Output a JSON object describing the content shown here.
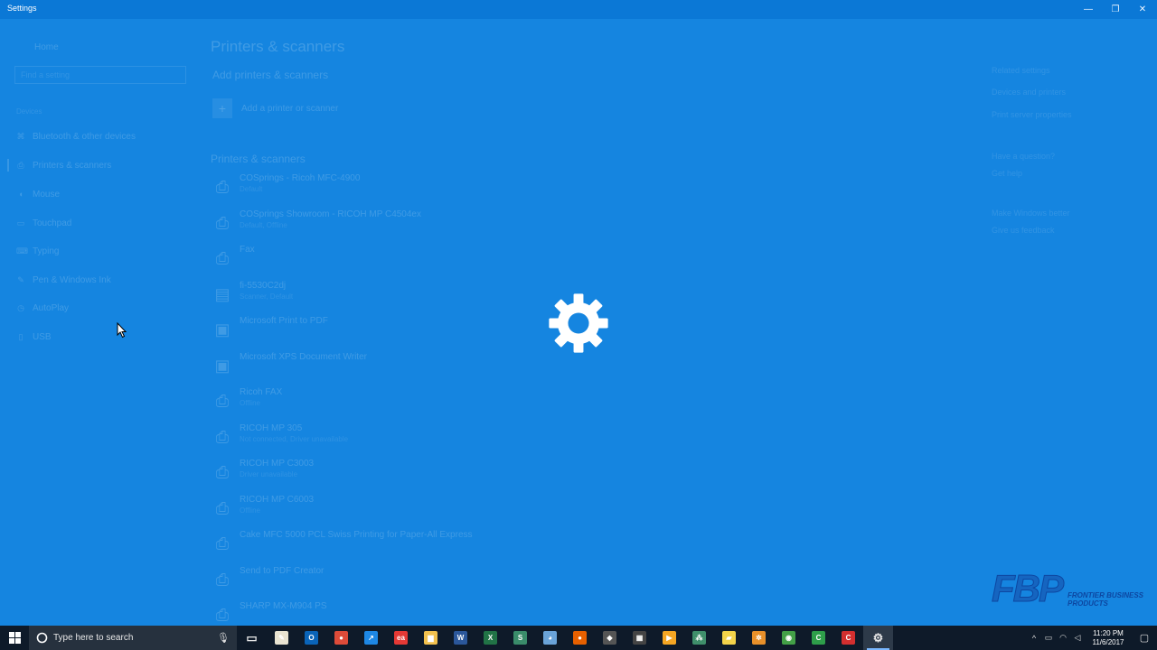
{
  "window": {
    "title": "Settings",
    "controls": {
      "minimize": "—",
      "restore": "❐",
      "close": "✕"
    }
  },
  "sidebar": {
    "home": "Home",
    "search_placeholder": "Find a setting",
    "section": "Devices",
    "items": [
      {
        "label": "Bluetooth & other devices",
        "icon": "bluetooth-icon",
        "glyph": "⌘"
      },
      {
        "label": "Printers & scanners",
        "icon": "printer-icon",
        "glyph": "⎙",
        "active": true
      },
      {
        "label": "Mouse",
        "icon": "mouse-icon",
        "glyph": "◖"
      },
      {
        "label": "Touchpad",
        "icon": "touchpad-icon",
        "glyph": "▭"
      },
      {
        "label": "Typing",
        "icon": "keyboard-icon",
        "glyph": "⌨"
      },
      {
        "label": "Pen & Windows Ink",
        "icon": "pen-icon",
        "glyph": "✎"
      },
      {
        "label": "AutoPlay",
        "icon": "autoplay-icon",
        "glyph": "◷"
      },
      {
        "label": "USB",
        "icon": "usb-icon",
        "glyph": "▯"
      }
    ]
  },
  "main": {
    "title": "Printers & scanners",
    "add_heading": "Add printers & scanners",
    "add_button": "Add a printer or scanner",
    "list_heading": "Printers & scanners",
    "printers": [
      {
        "name": "COSprings - Ricoh MFC-4900",
        "status": "Default",
        "icon": "printer-icon"
      },
      {
        "name": "COSprings Showroom - RICOH MP C4504ex",
        "status": "Default, Offline",
        "icon": "printer-icon"
      },
      {
        "name": "Fax",
        "status": "",
        "icon": "printer-icon"
      },
      {
        "name": "fi-5530C2dj",
        "status": "Scanner, Default",
        "icon": "scanner-icon"
      },
      {
        "name": "Microsoft Print to PDF",
        "status": "",
        "icon": "pdf-printer-icon"
      },
      {
        "name": "Microsoft XPS Document Writer",
        "status": "",
        "icon": "xps-printer-icon"
      },
      {
        "name": "Ricoh FAX",
        "status": "Offline",
        "icon": "printer-icon"
      },
      {
        "name": "RICOH MP 305",
        "status": "Not connected, Driver unavailable",
        "icon": "printer-icon"
      },
      {
        "name": "RICOH MP C3003",
        "status": "Driver unavailable",
        "icon": "printer-icon"
      },
      {
        "name": "RICOH MP C6003",
        "status": "Offline",
        "icon": "printer-icon"
      },
      {
        "name": "Cake MFC 5000 PCL Swiss Printing for Paper-All Express",
        "status": "",
        "icon": "printer-icon"
      },
      {
        "name": "Send to PDF Creator",
        "status": "",
        "icon": "printer-icon"
      },
      {
        "name": "SHARP MX-M904 PS",
        "status": "",
        "icon": "printer-icon"
      }
    ]
  },
  "related": {
    "heading": "Related settings",
    "links": [
      "Devices and printers",
      "Print server properties"
    ],
    "question_heading": "Have a question?",
    "question_link": "Get help",
    "feedback_heading": "Make Windows better",
    "feedback_link": "Give us feedback"
  },
  "overlay": {
    "spinner_icon": "gear-icon"
  },
  "logo": {
    "mark": "FBP",
    "line1": "FRONTIER BUSINESS",
    "line2": "PRODUCTS"
  },
  "taskbar": {
    "search_placeholder": "Type here to search",
    "apps": [
      {
        "name": "task-view",
        "glyph": "▭",
        "bg": "transparent"
      },
      {
        "name": "notepad",
        "glyph": "✎",
        "bg": "#e9e4d2"
      },
      {
        "name": "outlook",
        "glyph": "O",
        "bg": "#0a64b8"
      },
      {
        "name": "chrome",
        "glyph": "●",
        "bg": "#dd4b39"
      },
      {
        "name": "app-blue",
        "glyph": "↗",
        "bg": "#1e88e5"
      },
      {
        "name": "app-red",
        "glyph": "ea",
        "bg": "#e53935"
      },
      {
        "name": "file-explorer",
        "glyph": "▆",
        "bg": "#f2c14e"
      },
      {
        "name": "word",
        "glyph": "W",
        "bg": "#2b579a"
      },
      {
        "name": "excel",
        "glyph": "X",
        "bg": "#217346"
      },
      {
        "name": "app-s",
        "glyph": "S",
        "bg": "#3a8c6a"
      },
      {
        "name": "paint",
        "glyph": "◕",
        "bg": "#6aa3d8"
      },
      {
        "name": "firefox",
        "glyph": "●",
        "bg": "#e66000"
      },
      {
        "name": "app-box",
        "glyph": "◆",
        "bg": "#555"
      },
      {
        "name": "calculator",
        "glyph": "▦",
        "bg": "#444"
      },
      {
        "name": "media-player",
        "glyph": "▶",
        "bg": "#f5a623"
      },
      {
        "name": "app-dots",
        "glyph": "⁂",
        "bg": "#3f8f6b"
      },
      {
        "name": "sticky-notes",
        "glyph": "▰",
        "bg": "#f3d34a"
      },
      {
        "name": "app-orange",
        "glyph": "✲",
        "bg": "#e8902a"
      },
      {
        "name": "app-green",
        "glyph": "◉",
        "bg": "#43a047"
      },
      {
        "name": "camtasia",
        "glyph": "C",
        "bg": "#2e9e4a"
      },
      {
        "name": "app-red-c",
        "glyph": "C",
        "bg": "#d32f2f"
      },
      {
        "name": "settings",
        "glyph": "⚙",
        "bg": "transparent",
        "active": true
      }
    ],
    "tray": {
      "time": "11:20 PM",
      "date": "11/6/2017"
    }
  },
  "colors": {
    "background": "#1585e0",
    "titlebar": "#0b78d6",
    "taskbar": "#0e1a29"
  }
}
